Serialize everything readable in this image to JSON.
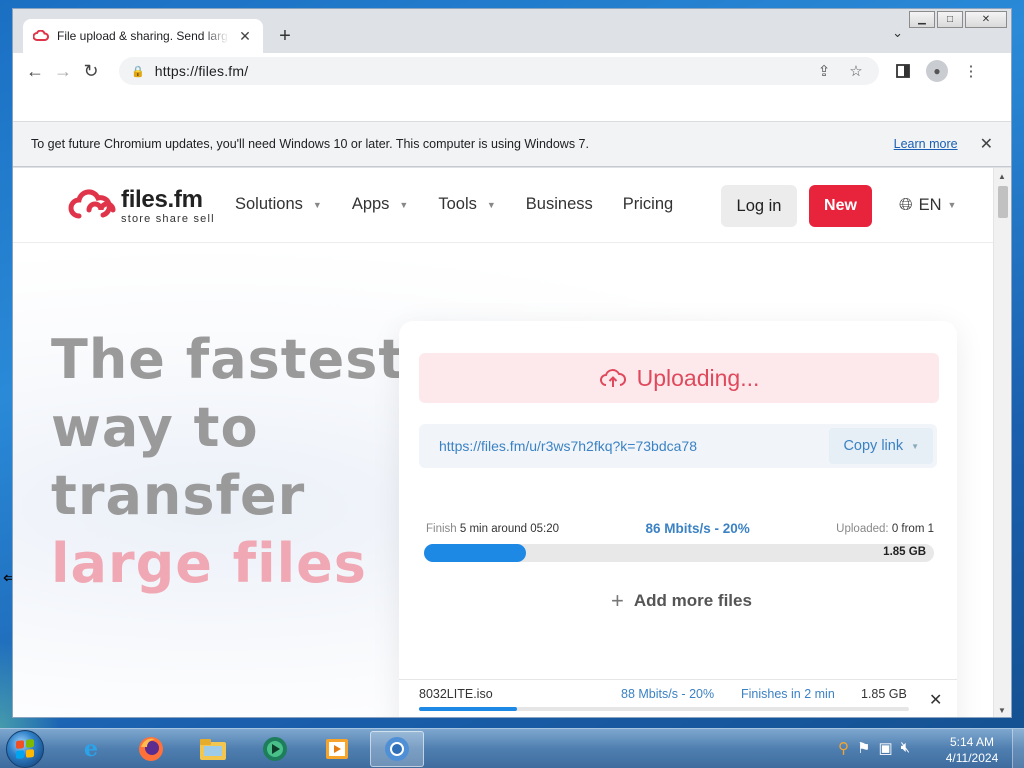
{
  "window": {
    "controls": {
      "minimize": "▭",
      "restore": "□",
      "close": "✕"
    }
  },
  "tab": {
    "title": "File upload & sharing. Send large files",
    "favicon": "files-fm-cloud-icon",
    "close": "✕",
    "new_tab": "+",
    "search_tabs": "⌄"
  },
  "toolbar": {
    "back": "←",
    "forward": "→",
    "reload": "↻",
    "url": "https://files.fm/",
    "share": "⇪",
    "bookmark": "☆",
    "side_panel": "▮",
    "menu": "⋮"
  },
  "infobar": {
    "message": "To get future Chromium updates, you'll need Windows 10 or later. This computer is using Windows 7.",
    "link": "Learn more",
    "close": "✕"
  },
  "site": {
    "logo_name": "files.fm",
    "logo_tagline": "store share sell",
    "nav": [
      {
        "label": "Solutions",
        "caret": "▼"
      },
      {
        "label": "Apps",
        "caret": "▼"
      },
      {
        "label": "Tools",
        "caret": "▼"
      },
      {
        "label": "Business",
        "caret": ""
      },
      {
        "label": "Pricing",
        "caret": ""
      }
    ],
    "login": "Log in",
    "new": "New",
    "lang": "EN",
    "lang_caret": "▼",
    "brand_color": "#e8233c"
  },
  "hero": {
    "line1": "The fastest",
    "line2": "way to",
    "line3": "transfer",
    "line4": "large files"
  },
  "upload": {
    "status": "Uploading...",
    "link": "https://files.fm/u/r3ws7h2fkq?k=73bdca78",
    "copy_label": "Copy link",
    "copy_caret": "▼",
    "finish_label": "Finish",
    "finish_value": "5 min around 05:20",
    "speed": "86 Mbits/s - 20%",
    "uploaded_label": "Uploaded:",
    "uploaded_value": "0 from 1",
    "total_size": "1.85 GB",
    "progress_pct": 20,
    "add_more_icon": "+",
    "add_more": "Add more files"
  },
  "file": {
    "name": "8032LITE.iso",
    "speed": "88 Mbits/s - 20%",
    "finish": "Finishes in 2 min",
    "size": "1.85 GB",
    "close": "✕",
    "progress_pct": 20
  },
  "taskbar": {
    "clock_time": "5:14 AM",
    "clock_date": "4/11/2024",
    "apps": [
      "internet-explorer",
      "firefox",
      "windows-explorer",
      "media-center",
      "media-player",
      "chromium"
    ]
  }
}
